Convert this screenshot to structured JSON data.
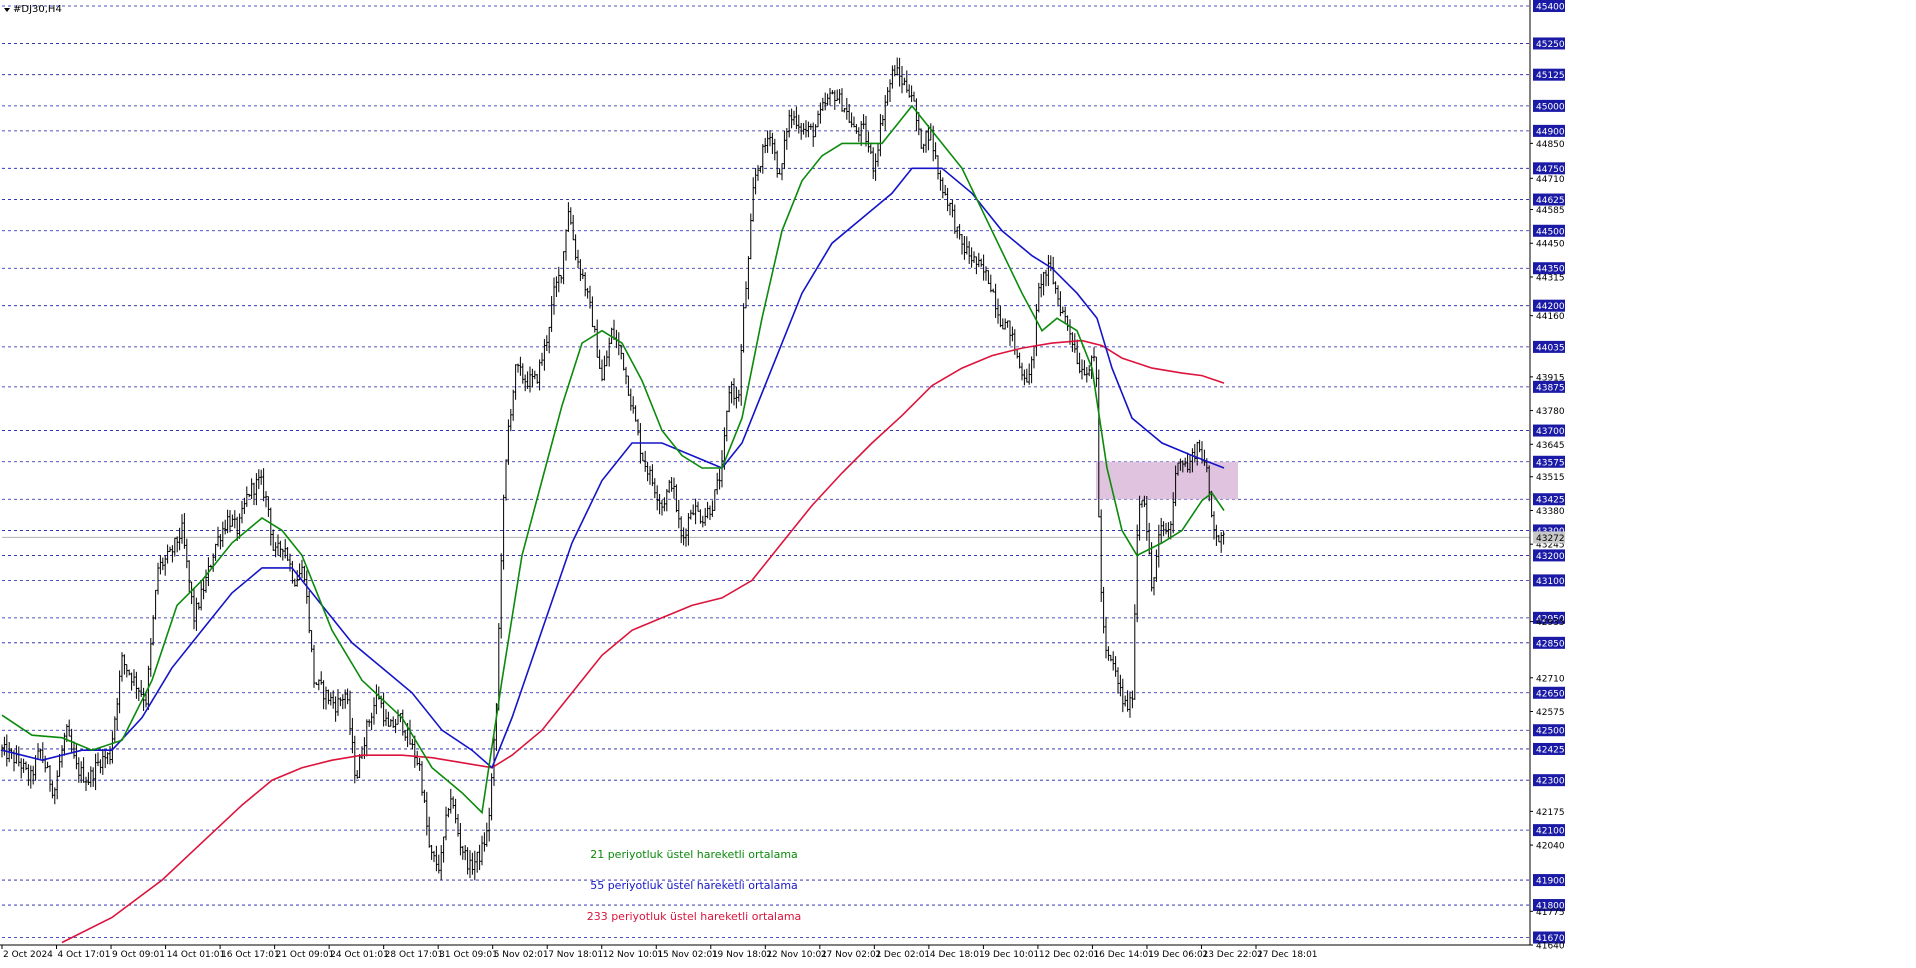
{
  "window": {
    "title": "#DJ30,H4"
  },
  "colors": {
    "background": "#ffffff",
    "grid": "#1a1aa6",
    "candle": "#000000",
    "ema21": "#0b8a0b",
    "ema55": "#1414c8",
    "ema233": "#dc143c",
    "zone": "#d9b8d9",
    "axis_label_bg": "#1a1aa6",
    "axis_label_text": "#ffffff",
    "current_price_line": "#b0b0b0"
  },
  "chart_data": {
    "type": "candlestick",
    "symbol": "#DJ30",
    "timeframe": "H4",
    "title": "#DJ30,H4",
    "grid": true,
    "ylim": [
      41640,
      45400
    ],
    "y_ticks_highlighted": [
      45400,
      45250,
      45125,
      45000,
      44900,
      44750,
      44625,
      44500,
      44350,
      44200,
      44035,
      43875,
      43700,
      43575,
      43425,
      43300,
      43200,
      43100,
      42950,
      42850,
      42650,
      42500,
      42425,
      42300,
      42100,
      41900,
      41800,
      41670
    ],
    "y_ticks_plain": [
      44850,
      44710,
      44585,
      44450,
      44315,
      44160,
      43915,
      43780,
      43645,
      43515,
      43380,
      43245,
      42935,
      42710,
      42575,
      42175,
      42040,
      41775,
      41640
    ],
    "current_price_label": "43272",
    "current_price": 43272,
    "x_ticks": [
      "2 Oct 2024",
      "4 Oct 17:01",
      "9 Oct 09:01",
      "14 Oct 01:01",
      "16 Oct 17:01",
      "21 Oct 09:01",
      "24 Oct 01:01",
      "28 Oct 17:01",
      "31 Oct 09:01",
      "5 Nov 02:01",
      "7 Nov 18:01",
      "12 Nov 10:01",
      "15 Nov 02:01",
      "19 Nov 18:01",
      "22 Nov 10:01",
      "27 Nov 02:01",
      "2 Dec 02:01",
      "4 Dec 18:01",
      "9 Dec 10:01",
      "12 Dec 02:01",
      "16 Dec 14:01",
      "19 Dec 06:01",
      "23 Dec 22:01",
      "27 Dec 18:01"
    ],
    "price_path": [
      [
        0,
        42420
      ],
      [
        18,
        42370
      ],
      [
        28,
        42300
      ],
      [
        38,
        42420
      ],
      [
        52,
        42250
      ],
      [
        64,
        42500
      ],
      [
        74,
        42350
      ],
      [
        86,
        42300
      ],
      [
        98,
        42380
      ],
      [
        108,
        42400
      ],
      [
        120,
        42780
      ],
      [
        132,
        42700
      ],
      [
        144,
        42620
      ],
      [
        156,
        43150
      ],
      [
        168,
        43200
      ],
      [
        180,
        43300
      ],
      [
        192,
        42950
      ],
      [
        204,
        43100
      ],
      [
        214,
        43250
      ],
      [
        226,
        43350
      ],
      [
        236,
        43300
      ],
      [
        246,
        43450
      ],
      [
        258,
        43500
      ],
      [
        266,
        43400
      ],
      [
        272,
        43200
      ],
      [
        282,
        43250
      ],
      [
        292,
        43100
      ],
      [
        302,
        43150
      ],
      [
        312,
        42700
      ],
      [
        322,
        42650
      ],
      [
        334,
        42600
      ],
      [
        344,
        42650
      ],
      [
        354,
        42300
      ],
      [
        364,
        42500
      ],
      [
        376,
        42650
      ],
      [
        386,
        42500
      ],
      [
        398,
        42550
      ],
      [
        408,
        42450
      ],
      [
        418,
        42350
      ],
      [
        428,
        42000
      ],
      [
        438,
        41950
      ],
      [
        448,
        42250
      ],
      [
        458,
        42050
      ],
      [
        468,
        41950
      ],
      [
        478,
        42000
      ],
      [
        486,
        42100
      ],
      [
        494,
        42550
      ],
      [
        500,
        43300
      ],
      [
        506,
        43700
      ],
      [
        514,
        43950
      ],
      [
        524,
        43900
      ],
      [
        534,
        43900
      ],
      [
        544,
        44050
      ],
      [
        552,
        44250
      ],
      [
        560,
        44350
      ],
      [
        566,
        44600
      ],
      [
        574,
        44400
      ],
      [
        582,
        44300
      ],
      [
        590,
        44150
      ],
      [
        600,
        43900
      ],
      [
        610,
        44100
      ],
      [
        620,
        44000
      ],
      [
        630,
        43800
      ],
      [
        640,
        43600
      ],
      [
        650,
        43500
      ],
      [
        660,
        43400
      ],
      [
        670,
        43500
      ],
      [
        680,
        43250
      ],
      [
        690,
        43400
      ],
      [
        700,
        43350
      ],
      [
        710,
        43400
      ],
      [
        720,
        43550
      ],
      [
        728,
        43900
      ],
      [
        736,
        43800
      ],
      [
        742,
        44200
      ],
      [
        746,
        44350
      ],
      [
        752,
        44700
      ],
      [
        760,
        44800
      ],
      [
        768,
        44900
      ],
      [
        778,
        44700
      ],
      [
        786,
        44950
      ],
      [
        794,
        44950
      ],
      [
        802,
        44900
      ],
      [
        812,
        44900
      ],
      [
        822,
        45000
      ],
      [
        832,
        45050
      ],
      [
        842,
        45000
      ],
      [
        852,
        44900
      ],
      [
        862,
        44900
      ],
      [
        872,
        44750
      ],
      [
        882,
        45000
      ],
      [
        892,
        45150
      ],
      [
        900,
        45100
      ],
      [
        910,
        45050
      ],
      [
        918,
        44850
      ],
      [
        928,
        44900
      ],
      [
        938,
        44700
      ],
      [
        948,
        44600
      ],
      [
        958,
        44450
      ],
      [
        968,
        44400
      ],
      [
        978,
        44350
      ],
      [
        988,
        44300
      ],
      [
        998,
        44150
      ],
      [
        1008,
        44100
      ],
      [
        1018,
        43950
      ],
      [
        1028,
        43900
      ],
      [
        1038,
        44300
      ],
      [
        1048,
        44350
      ],
      [
        1058,
        44200
      ],
      [
        1068,
        44100
      ],
      [
        1078,
        43950
      ],
      [
        1088,
        43950
      ],
      [
        1094,
        44000
      ],
      [
        1098,
        43100
      ],
      [
        1104,
        42800
      ],
      [
        1112,
        42750
      ],
      [
        1122,
        42600
      ],
      [
        1130,
        42600
      ],
      [
        1136,
        43400
      ],
      [
        1142,
        43450
      ],
      [
        1150,
        43050
      ],
      [
        1158,
        43300
      ],
      [
        1168,
        43300
      ],
      [
        1176,
        43600
      ],
      [
        1186,
        43550
      ],
      [
        1196,
        43650
      ],
      [
        1204,
        43550
      ],
      [
        1210,
        43350
      ],
      [
        1218,
        43250
      ],
      [
        1224,
        43272
      ]
    ],
    "ema21_path": [
      [
        0,
        42560
      ],
      [
        30,
        42480
      ],
      [
        60,
        42470
      ],
      [
        90,
        42420
      ],
      [
        120,
        42460
      ],
      [
        150,
        42700
      ],
      [
        175,
        43000
      ],
      [
        200,
        43100
      ],
      [
        230,
        43250
      ],
      [
        260,
        43350
      ],
      [
        280,
        43300
      ],
      [
        300,
        43200
      ],
      [
        330,
        42900
      ],
      [
        360,
        42700
      ],
      [
        400,
        42550
      ],
      [
        430,
        42350
      ],
      [
        460,
        42250
      ],
      [
        480,
        42170
      ],
      [
        500,
        42700
      ],
      [
        520,
        43200
      ],
      [
        540,
        43500
      ],
      [
        560,
        43800
      ],
      [
        580,
        44050
      ],
      [
        600,
        44100
      ],
      [
        620,
        44050
      ],
      [
        640,
        43900
      ],
      [
        660,
        43700
      ],
      [
        680,
        43600
      ],
      [
        700,
        43550
      ],
      [
        720,
        43550
      ],
      [
        740,
        43750
      ],
      [
        760,
        44150
      ],
      [
        780,
        44500
      ],
      [
        800,
        44700
      ],
      [
        820,
        44800
      ],
      [
        840,
        44850
      ],
      [
        860,
        44850
      ],
      [
        880,
        44850
      ],
      [
        900,
        44950
      ],
      [
        910,
        45000
      ],
      [
        930,
        44900
      ],
      [
        960,
        44750
      ],
      [
        990,
        44500
      ],
      [
        1020,
        44250
      ],
      [
        1040,
        44100
      ],
      [
        1055,
        44150
      ],
      [
        1075,
        44100
      ],
      [
        1090,
        43950
      ],
      [
        1105,
        43550
      ],
      [
        1120,
        43300
      ],
      [
        1135,
        43200
      ],
      [
        1160,
        43250
      ],
      [
        1180,
        43300
      ],
      [
        1200,
        43420
      ],
      [
        1210,
        43450
      ],
      [
        1222,
        43380
      ]
    ],
    "ema55_path": [
      [
        0,
        42420
      ],
      [
        40,
        42380
      ],
      [
        80,
        42420
      ],
      [
        110,
        42420
      ],
      [
        140,
        42550
      ],
      [
        170,
        42750
      ],
      [
        200,
        42900
      ],
      [
        230,
        43050
      ],
      [
        260,
        43150
      ],
      [
        290,
        43150
      ],
      [
        320,
        43000
      ],
      [
        350,
        42850
      ],
      [
        380,
        42750
      ],
      [
        410,
        42650
      ],
      [
        440,
        42500
      ],
      [
        470,
        42420
      ],
      [
        490,
        42350
      ],
      [
        510,
        42550
      ],
      [
        540,
        42900
      ],
      [
        570,
        43250
      ],
      [
        600,
        43500
      ],
      [
        630,
        43650
      ],
      [
        660,
        43650
      ],
      [
        690,
        43600
      ],
      [
        720,
        43550
      ],
      [
        740,
        43650
      ],
      [
        770,
        43950
      ],
      [
        800,
        44250
      ],
      [
        830,
        44450
      ],
      [
        860,
        44550
      ],
      [
        890,
        44650
      ],
      [
        910,
        44750
      ],
      [
        940,
        44750
      ],
      [
        970,
        44650
      ],
      [
        1000,
        44500
      ],
      [
        1030,
        44400
      ],
      [
        1050,
        44350
      ],
      [
        1075,
        44250
      ],
      [
        1095,
        44150
      ],
      [
        1110,
        43950
      ],
      [
        1130,
        43750
      ],
      [
        1160,
        43650
      ],
      [
        1190,
        43600
      ],
      [
        1222,
        43550
      ]
    ],
    "ema233_path": [
      [
        60,
        41650
      ],
      [
        110,
        41750
      ],
      [
        160,
        41900
      ],
      [
        200,
        42050
      ],
      [
        240,
        42200
      ],
      [
        270,
        42300
      ],
      [
        300,
        42350
      ],
      [
        330,
        42380
      ],
      [
        360,
        42400
      ],
      [
        400,
        42400
      ],
      [
        430,
        42390
      ],
      [
        460,
        42370
      ],
      [
        490,
        42350
      ],
      [
        510,
        42400
      ],
      [
        540,
        42500
      ],
      [
        570,
        42650
      ],
      [
        600,
        42800
      ],
      [
        630,
        42900
      ],
      [
        660,
        42950
      ],
      [
        690,
        43000
      ],
      [
        720,
        43030
      ],
      [
        750,
        43100
      ],
      [
        780,
        43250
      ],
      [
        810,
        43400
      ],
      [
        840,
        43530
      ],
      [
        870,
        43650
      ],
      [
        900,
        43760
      ],
      [
        930,
        43880
      ],
      [
        960,
        43950
      ],
      [
        990,
        44000
      ],
      [
        1020,
        44030
      ],
      [
        1050,
        44050
      ],
      [
        1080,
        44060
      ],
      [
        1100,
        44040
      ],
      [
        1120,
        43990
      ],
      [
        1150,
        43950
      ],
      [
        1180,
        43930
      ],
      [
        1200,
        43920
      ],
      [
        1222,
        43890
      ]
    ],
    "zone": {
      "x_start": 1094,
      "x_end": 1236,
      "y_low": 43425,
      "y_high": 43575
    },
    "annotations": [
      {
        "text": "21 periyotluk üstel hareketli ortalama",
        "series": "ema21"
      },
      {
        "text": "55 periyotluk üstel hareketli ortalama",
        "series": "ema55"
      },
      {
        "text": "233 periyotluk üstel hareketli ortalama",
        "series": "ema233"
      }
    ]
  }
}
